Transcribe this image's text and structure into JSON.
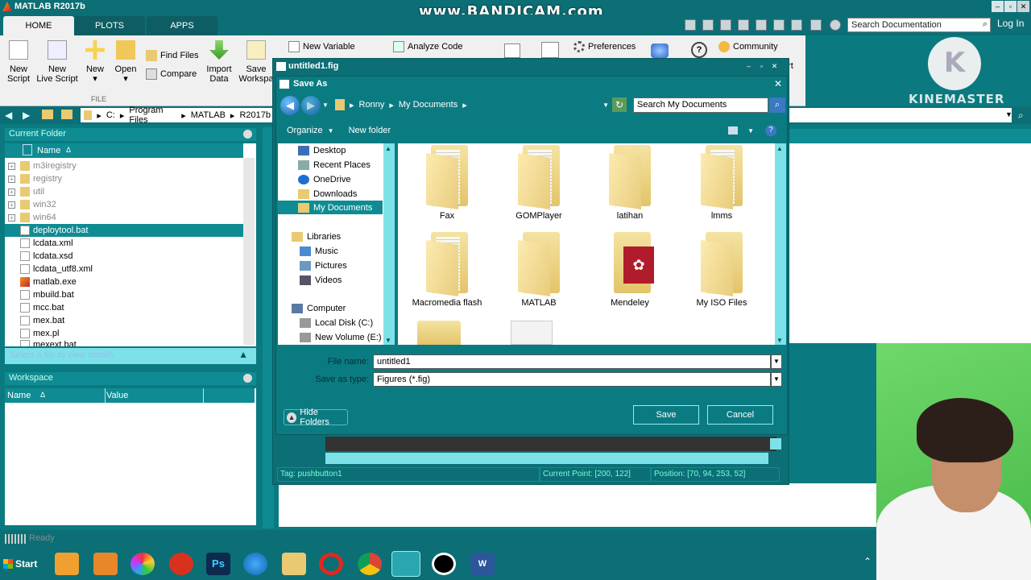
{
  "app": {
    "title": "MATLAB R2017b"
  },
  "watermark": "www.BANDICAM.com",
  "ribbon_tabs": [
    {
      "label": "HOME"
    },
    {
      "label": "PLOTS"
    },
    {
      "label": "APPS"
    }
  ],
  "doc_search": {
    "placeholder": "Search Documentation"
  },
  "login": "Log In",
  "ribbon": {
    "new_script": "New\nScript",
    "new_live_script": "New\nLive Script",
    "new": "New",
    "open": "Open",
    "find_files": "Find Files",
    "compare": "Compare",
    "import_data": "Import\nData",
    "save_workspace": "Save\nWorkspa",
    "new_variable": "New Variable",
    "analyze_code": "Analyze Code",
    "preferences": "Preferences",
    "community": "Community",
    "request_support_frag": "ort",
    "group_file": "FILE"
  },
  "kinemaster": {
    "logo": "K",
    "label": "KINEMASTER"
  },
  "address": {
    "segments": [
      "C:",
      "Program Files",
      "MATLAB",
      "R2017b"
    ]
  },
  "current_folder": {
    "title": "Current Folder",
    "col_name": "Name",
    "sort_indicator": "Δ",
    "rows": [
      {
        "name": "m3iregistry",
        "type": "folder",
        "dim": true
      },
      {
        "name": "registry",
        "type": "folder",
        "dim": true
      },
      {
        "name": "util",
        "type": "folder",
        "dim": true
      },
      {
        "name": "win32",
        "type": "folder",
        "dim": true
      },
      {
        "name": "win64",
        "type": "folder",
        "dim": true
      },
      {
        "name": "deploytool.bat",
        "type": "file",
        "sel": true
      },
      {
        "name": "lcdata.xml",
        "type": "file"
      },
      {
        "name": "lcdata.xsd",
        "type": "file"
      },
      {
        "name": "lcdata_utf8.xml",
        "type": "file"
      },
      {
        "name": "matlab.exe",
        "type": "file"
      },
      {
        "name": "mbuild.bat",
        "type": "file"
      },
      {
        "name": "mcc.bat",
        "type": "file"
      },
      {
        "name": "mex.bat",
        "type": "file"
      },
      {
        "name": "mex.pl",
        "type": "file"
      },
      {
        "name": "mexext.bat",
        "type": "file"
      }
    ],
    "details": "Select a file to view details"
  },
  "workspace": {
    "title": "Workspace",
    "col_name": "Name",
    "sort_indicator": "Δ",
    "col_value": "Value"
  },
  "guide": {
    "title": "untitled1.fig",
    "status_tag": "Tag: pushbutton1",
    "status_point": "Current Point:  [200, 122]",
    "status_position": "Position: [70, 94, 253, 52]"
  },
  "save_dialog": {
    "title": "Save As",
    "breadcrumb": [
      "Ronny",
      "My Documents"
    ],
    "search_placeholder": "Search My Documents",
    "organize": "Organize",
    "new_folder": "New folder",
    "nav": [
      {
        "label": "Desktop"
      },
      {
        "label": "Recent Places"
      },
      {
        "label": "OneDrive"
      },
      {
        "label": "Downloads"
      },
      {
        "label": "My Documents"
      },
      {
        "label": "Libraries"
      },
      {
        "label": "Music"
      },
      {
        "label": "Pictures"
      },
      {
        "label": "Videos"
      },
      {
        "label": "Computer"
      },
      {
        "label": "Local Disk (C:)"
      },
      {
        "label": "New Volume (E:)"
      }
    ],
    "files": [
      {
        "name": "Fax"
      },
      {
        "name": "GOMPlayer"
      },
      {
        "name": "latihan"
      },
      {
        "name": "lmms"
      },
      {
        "name": "Macromedia flash"
      },
      {
        "name": "MATLAB"
      },
      {
        "name": "Mendeley"
      },
      {
        "name": "My ISO Files"
      }
    ],
    "file_name_label": "File name:",
    "file_name_value": "untitled1",
    "save_type_label": "Save as type:",
    "save_type_value": "Figures (*.fig)",
    "hide_folders": "Hide Folders",
    "save": "Save",
    "cancel": "Cancel"
  },
  "status": {
    "text": "Ready"
  },
  "taskbar": {
    "start": "Start",
    "apps": [
      "media-player-icon",
      "sublime-icon",
      "picasa-icon",
      "flash-icon",
      "photoshop-icon",
      "ie-icon",
      "explorer-icon",
      "opera-icon",
      "chrome-icon",
      "matlab-icon",
      "record-icon",
      "word-icon"
    ]
  },
  "colors": {
    "teal": "#0b6f75",
    "accent": "#0f8c93",
    "cyan": "#7de2e8"
  }
}
